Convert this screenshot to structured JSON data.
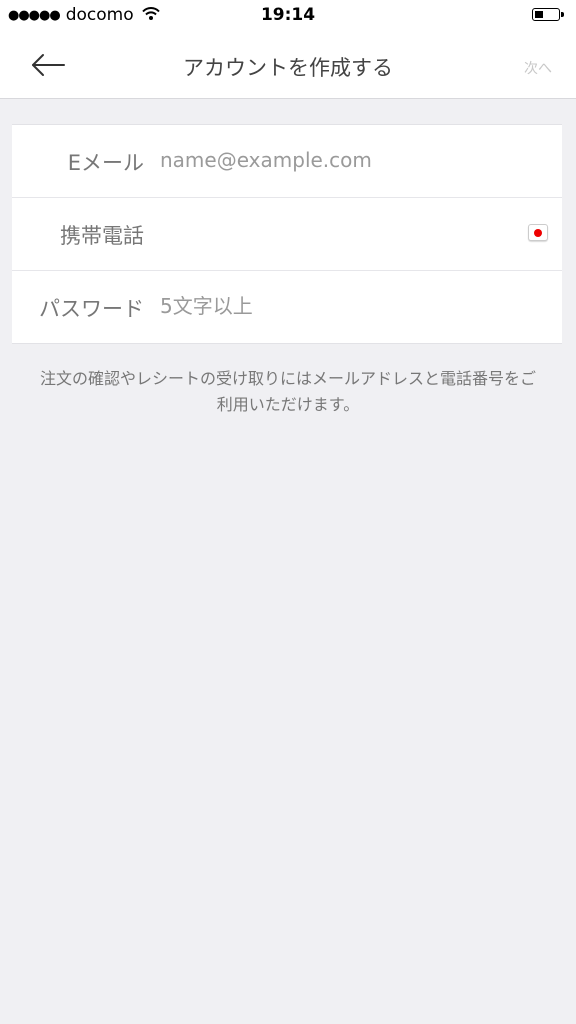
{
  "status_bar": {
    "signal": "●●●●●",
    "carrier": "docomo",
    "time": "19:14"
  },
  "nav": {
    "title": "アカウントを作成する",
    "next_label": "次へ"
  },
  "form": {
    "email": {
      "label": "Eメール",
      "placeholder": "name@example.com",
      "value": ""
    },
    "phone": {
      "label": "携帯電話",
      "value": ""
    },
    "password": {
      "label": "パスワード",
      "placeholder": "5文字以上",
      "value": ""
    }
  },
  "note": "注文の確認やレシートの受け取りにはメールアドレスと電話番号をご利用いただけます。",
  "colors": {
    "background": "#f0f0f3",
    "flag_red": "#ee0000"
  }
}
